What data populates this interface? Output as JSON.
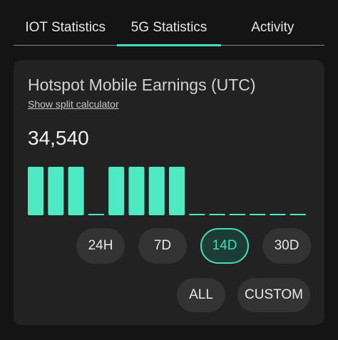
{
  "tabs": [
    {
      "label": "IOT Statistics",
      "active": false
    },
    {
      "label": "5G Statistics",
      "active": true
    },
    {
      "label": "Activity",
      "active": false
    }
  ],
  "card": {
    "title": "Hotspot Mobile Earnings (UTC)",
    "split_link": "Show split calculator",
    "total": "34,540"
  },
  "chart_data": {
    "type": "bar",
    "values": [
      1,
      1,
      1,
      0,
      1,
      1,
      1,
      1,
      0,
      0,
      0,
      0,
      0,
      0
    ],
    "color": "#4eeac3"
  },
  "ranges": {
    "h24": "24H",
    "d7": "7D",
    "d14": "14D",
    "d30": "30D",
    "all": "ALL",
    "custom": "CUSTOM",
    "selected": "14D"
  },
  "colors": {
    "accent": "#3fe0b9",
    "background": "#141414",
    "card": "#222222"
  }
}
